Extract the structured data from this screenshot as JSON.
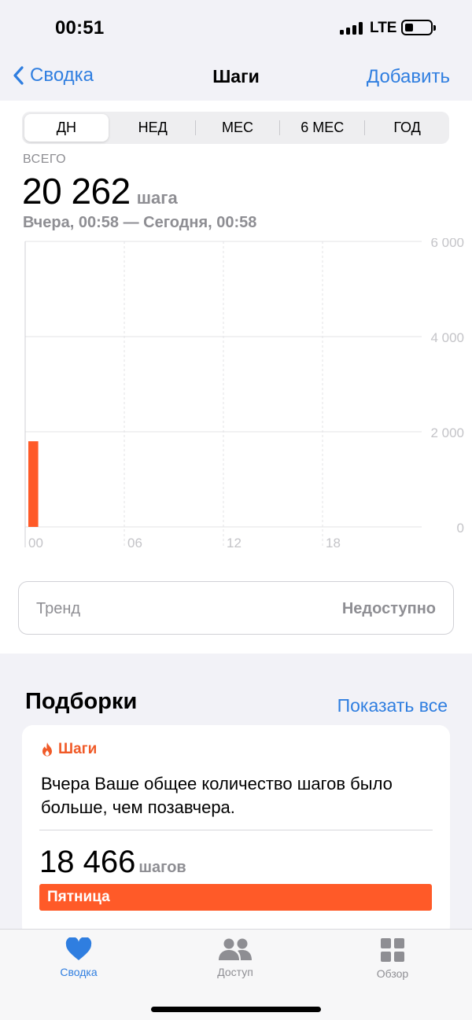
{
  "status_bar": {
    "time": "00:51",
    "network": "LTE"
  },
  "nav": {
    "back_label": "Сводка",
    "title": "Шаги",
    "action_label": "Добавить"
  },
  "range_tabs": [
    {
      "label": "ДН",
      "active": true
    },
    {
      "label": "НЕД",
      "active": false
    },
    {
      "label": "МЕС",
      "active": false
    },
    {
      "label": "6 МЕС",
      "active": false
    },
    {
      "label": "ГОД",
      "active": false
    }
  ],
  "summary": {
    "label": "ВСЕГО",
    "value": "20 262",
    "unit": "шага",
    "range": "Вчера, 00:58 — Сегодня, 00:58"
  },
  "chart_data": {
    "type": "bar",
    "x_ticks": [
      "00",
      "06",
      "12",
      "18"
    ],
    "y_ticks": [
      "6 000",
      "4 000",
      "2 000",
      "0"
    ],
    "ylim": [
      0,
      6000
    ],
    "xlim": [
      0,
      24
    ],
    "bars": [
      {
        "hour": 0,
        "value": 1800
      }
    ],
    "colors": {
      "bar": "#ff5a28",
      "grid": "#e3e3e6",
      "label": "#c4c4c8"
    }
  },
  "trend": {
    "label": "Тренд",
    "value": "Недоступно"
  },
  "highlights": {
    "title": "Подборки",
    "show_all": "Показать все",
    "card": {
      "category": "Шаги",
      "text": "Вчера Ваше общее количество шагов было больше, чем позавчера.",
      "value": "18 466",
      "unit": "шагов",
      "bar_label": "Пятница"
    }
  },
  "tabbar": [
    {
      "label": "Сводка",
      "icon": "heart-icon",
      "active": true
    },
    {
      "label": "Доступ",
      "icon": "people-icon",
      "active": false
    },
    {
      "label": "Обзор",
      "icon": "grid-icon",
      "active": false
    }
  ],
  "colors": {
    "accent": "#2f7ee0",
    "steps": "#ff5a28"
  }
}
